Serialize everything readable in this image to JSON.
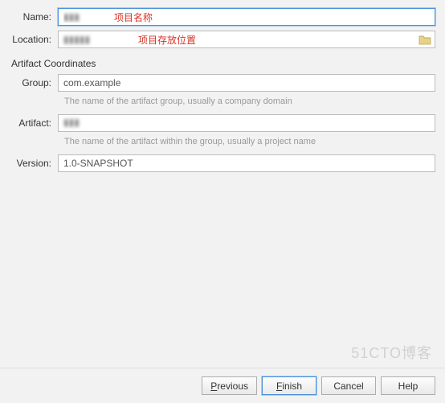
{
  "labels": {
    "name": "Name:",
    "location": "Location:",
    "group": "Group:",
    "artifact": "Artifact:",
    "version": "Version:"
  },
  "values": {
    "name": "▮▮▮",
    "location": "▮▮▮▮▮",
    "group": "com.example",
    "artifact": "▮▮▮",
    "version": "1.0-SNAPSHOT"
  },
  "annotations": {
    "name": "项目名称",
    "location": "项目存放位置"
  },
  "section": {
    "coordinates": "Artifact Coordinates"
  },
  "hints": {
    "group": "The name of the artifact group, usually a company domain",
    "artifact": "The name of the artifact within the group, usually a project name"
  },
  "buttons": {
    "previous": "Previous",
    "finish": "Finish",
    "cancel": "Cancel",
    "help": "Help"
  },
  "watermark": "51CTO博客"
}
